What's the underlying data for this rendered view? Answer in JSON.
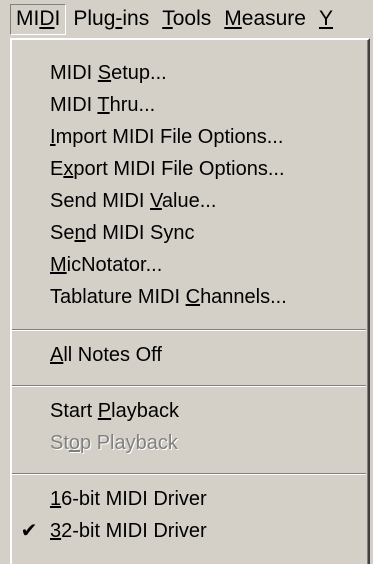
{
  "menubar": {
    "items": [
      {
        "pre": "MI",
        "key": "D",
        "post": "I"
      },
      {
        "pre": "Plug",
        "key": "-",
        "post": "ins"
      },
      {
        "pre": "",
        "key": "T",
        "post": "ools"
      },
      {
        "pre": "",
        "key": "M",
        "post": "easure"
      },
      {
        "pre": "",
        "key": "Y",
        "post": ""
      }
    ]
  },
  "menu": {
    "items": [
      {
        "pre": "MIDI ",
        "key": "S",
        "post": "etup..."
      },
      {
        "pre": "MIDI ",
        "key": "T",
        "post": "hru..."
      },
      {
        "pre": "",
        "key": "I",
        "post": "mport MIDI File Options..."
      },
      {
        "pre": "E",
        "key": "x",
        "post": "port MIDI File Options..."
      },
      {
        "pre": "Send MIDI ",
        "key": "V",
        "post": "alue..."
      },
      {
        "pre": "Se",
        "key": "n",
        "post": "d MIDI Sync"
      },
      {
        "pre": "",
        "key": "M",
        "post": "icNotator..."
      },
      {
        "pre": "Tablature MIDI ",
        "key": "C",
        "post": "hannels..."
      },
      {
        "pre": "",
        "key": "A",
        "post": "ll Notes Off"
      },
      {
        "pre": "Start ",
        "key": "P",
        "post": "layback"
      },
      {
        "pre": "St",
        "key": "o",
        "post": "p Playback"
      },
      {
        "pre": "",
        "key": "1",
        "post": "6-bit MIDI Driver"
      },
      {
        "pre": "",
        "key": "3",
        "post": "2-bit MIDI Driver"
      }
    ],
    "check_glyph": "✔"
  }
}
